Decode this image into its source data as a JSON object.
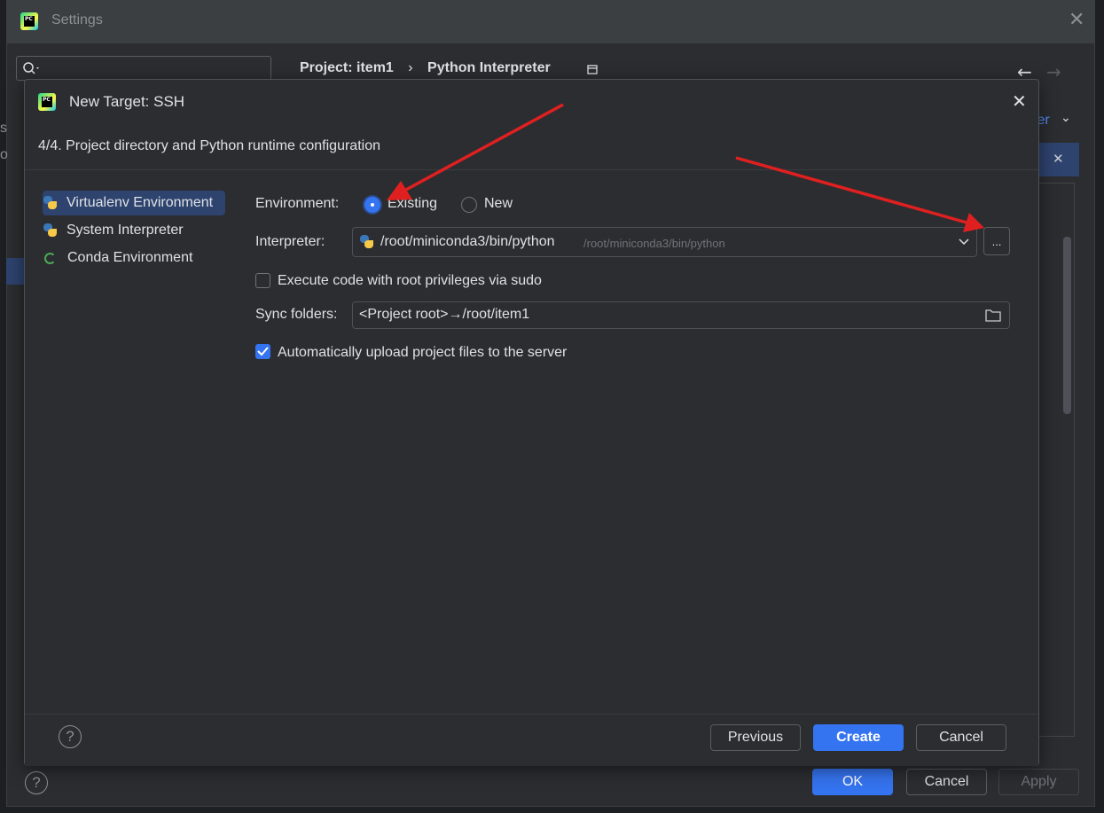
{
  "settings": {
    "title": "Settings",
    "breadcrumb": [
      "Project: item1",
      "›",
      "Python Interpreter"
    ],
    "partial_link": "ter",
    "buttons": {
      "ok": "OK",
      "cancel": "Cancel",
      "apply": "Apply"
    },
    "left_edge_chars": [
      "s",
      "o"
    ]
  },
  "dialog": {
    "title": "New Target: SSH",
    "step": "4/4. Project directory and Python runtime configuration",
    "environments": [
      {
        "label": "Virtualenv Environment",
        "icon": "virtualenv-icon",
        "selected": true
      },
      {
        "label": "System Interpreter",
        "icon": "python-icon",
        "selected": false
      },
      {
        "label": "Conda Environment",
        "icon": "conda-icon",
        "selected": false
      }
    ],
    "environment_label": "Environment:",
    "environment_options": {
      "existing": "Existing",
      "new": "New",
      "selected": "Existing"
    },
    "interpreter_label": "Interpreter:",
    "interpreter_value": "/root/miniconda3/bin/python",
    "interpreter_hint": "/root/miniconda3/bin/python",
    "browse_label": "...",
    "sudo_label": "Execute code with root privileges via sudo",
    "sudo_checked": false,
    "sync_label": "Sync folders:",
    "sync_value": "<Project root>→/root/item1",
    "upload_label": "Automatically upload project files to the server",
    "upload_checked": true,
    "buttons": {
      "previous": "Previous",
      "create": "Create",
      "cancel": "Cancel"
    },
    "help": "?"
  },
  "colors": {
    "accent": "#3574f0",
    "background": "#2b2d30",
    "arrow": "#e02020"
  }
}
